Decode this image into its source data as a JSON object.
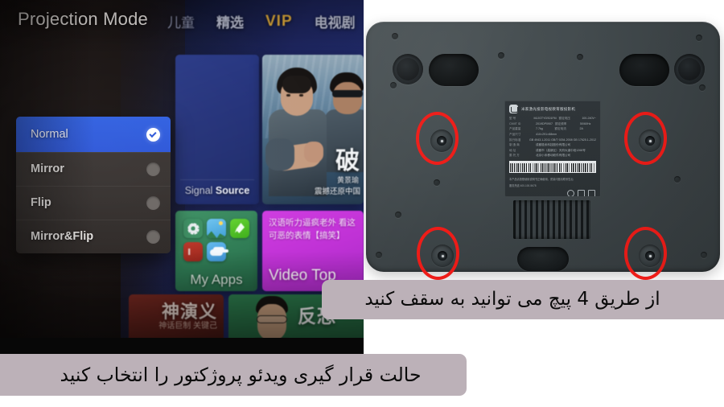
{
  "left_panel": {
    "name": "tv-projector-menu-photo",
    "title": "Projection Mode",
    "nav": [
      {
        "label": "儿童",
        "style": "dim"
      },
      {
        "label": "精选",
        "style": "normal"
      },
      {
        "label": "VIP",
        "style": "vip"
      },
      {
        "label": "电视剧",
        "style": "normal"
      }
    ],
    "projection_menu": {
      "name": "projection-mode-list",
      "options": [
        {
          "label": "Normal",
          "selected": true
        },
        {
          "label": "Mirror",
          "selected": false
        },
        {
          "label": "Flip",
          "selected": false
        },
        {
          "label": "Mirror&Flip",
          "selected": false
        }
      ]
    },
    "tiles": {
      "signal_source": {
        "label_light": "Signal ",
        "label_bold": "Source"
      },
      "my_apps": {
        "label": "My Apps",
        "icons": [
          "gear-icon",
          "photos-icon",
          "rocket-icon",
          "mi-icon",
          "cloud-icon"
        ]
      },
      "video_top": {
        "line1": "汉语听力逼疯老外 看这",
        "line2": "可恶的表情【搞笑】",
        "title": "Video Top"
      },
      "poster": {
        "headline": "破",
        "sub1": "黄景瑜",
        "sub2": "震撼还原中国"
      },
      "red_tile": {
        "headline": "神演义",
        "sub": "神话巨制\n关键己"
      },
      "green_tile": {
        "headline": "反恐"
      }
    }
  },
  "right_panel": {
    "name": "projector-bottom-photo",
    "device": "Mi projector underside",
    "screw_count": 4,
    "highlight_color": "#ee1c18",
    "label": {
      "brand_title": "米家激光投影电视教育版投影机",
      "rows": [
        {
          "k": "型    号",
          "v": "MJJGTYDS01FM",
          "k2": "额定电压",
          "v2": "100-240V~"
        },
        {
          "k": "CMIIT ID",
          "v": "2019DP0907",
          "k2": "额定频率",
          "v2": "50/60Hz"
        },
        {
          "k": "产品重量",
          "v": "7.7kg",
          "k2": "额定电流",
          "v2": "2A"
        },
        {
          "k": "产品尺寸",
          "v": "410×291×88mm",
          "k2": "",
          "v2": ""
        },
        {
          "k": "执行标准",
          "v": "GB 4943.1-2011 GB/T 9254-2008 GB 17625.1-2012",
          "k2": "",
          "v2": ""
        },
        {
          "k": "制 造 商",
          "v": "成都极米科技股份有限公司",
          "k2": "",
          "v2": ""
        },
        {
          "k": "地    址",
          "v": "成都市（高新区）天府大道中段1268号",
          "k2": "",
          "v2": ""
        },
        {
          "k": "委 托 方",
          "v": "北京小米移动软件有限公司",
          "k2": "",
          "v2": ""
        }
      ],
      "barcode_number": "SN: 20190711001",
      "footer": "本产品请按照使用说明书正确使用，质量问题请联系售后",
      "service": "服务热线  400-100-5678"
    }
  },
  "captions": {
    "top": "از طریق 4 پیچ می توانید به سقف کنید",
    "bottom": "حالت قرار گیری ویدئو پروژکتور را انتخاب کنید",
    "background_color": "#bcb1b8",
    "text_color": "#0a0a0a"
  }
}
